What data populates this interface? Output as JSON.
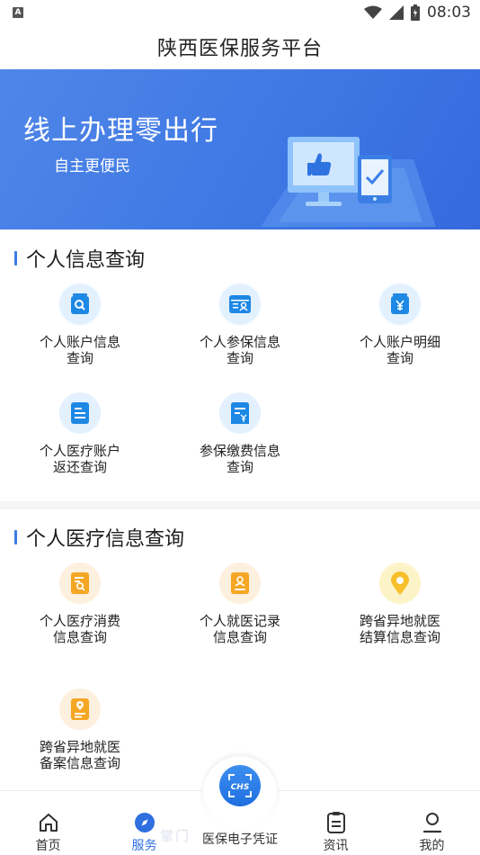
{
  "status_bar": {
    "left_badge": "A",
    "time": "08:03"
  },
  "app": {
    "title": "陕西医保服务平台"
  },
  "banner": {
    "title": "线上办理零出行",
    "subtitle": "自主更便民"
  },
  "sections": [
    {
      "title": "个人信息查询",
      "items": [
        {
          "label": "个人账户信息查询",
          "icon": "search-card-icon"
        },
        {
          "label": "个人参保信息查询",
          "icon": "id-card-icon"
        },
        {
          "label": "个人账户明细查询",
          "icon": "yuan-card-icon"
        },
        {
          "label": "个人医疗账户返还查询",
          "icon": "document-list-icon"
        },
        {
          "label": "参保缴费信息查询",
          "icon": "bill-yuan-icon"
        }
      ]
    },
    {
      "title": "个人医疗信息查询",
      "items": [
        {
          "label": "个人医疗消费信息查询",
          "icon": "receipt-search-icon"
        },
        {
          "label": "个人就医记录信息查询",
          "icon": "medical-record-icon"
        },
        {
          "label": "跨省异地就医结算信息查询",
          "icon": "location-pin-icon"
        },
        {
          "label": "跨省异地就医备案信息查询",
          "icon": "location-document-icon"
        }
      ]
    }
  ],
  "bottom_nav": {
    "home": "首页",
    "service": "服务",
    "certificate": "医保电子凭证",
    "center_logo": "CHS",
    "news": "资讯",
    "mine": "我的",
    "watermark": "掌门"
  },
  "colors": {
    "accent": "#2f6fe0",
    "banner": "#4a80e6",
    "icon_blue": "#1e88e5",
    "icon_orange": "#f5a623",
    "icon_yellow": "#f7c02b"
  }
}
